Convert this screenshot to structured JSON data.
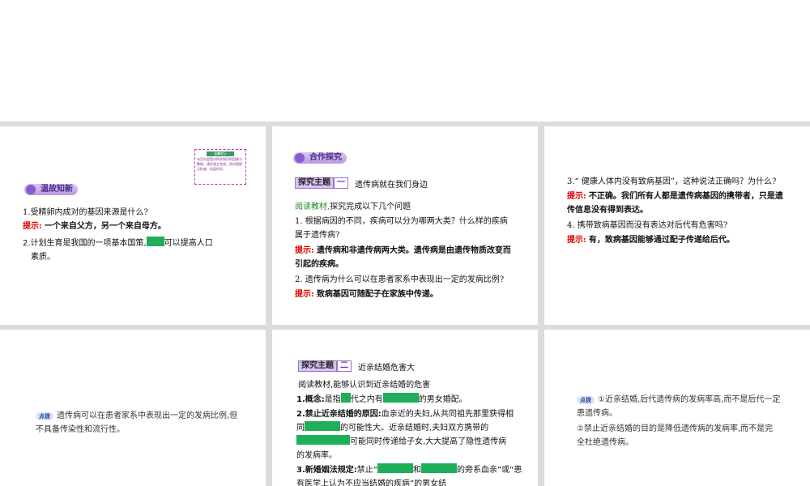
{
  "slide1": {
    "section_label": "温故知新",
    "note_title": "温馨提示",
    "note_body": "本页内容是对所学知识的回顾与整理，请先独立完成，再对照提示检查，巩固所学。",
    "q1": "1.受精卵内成对的基因来源是什么?",
    "q1_hint_label": "提示:",
    "q1_hint": "一个来自父方，另一个来自母方。",
    "q2_part1": "2.计划生育是我国的一项基本国策,",
    "q2_part2": "可以提高人口",
    "q2_part3": "素质。"
  },
  "slide2": {
    "section_label": "合作探究",
    "topic_label": "探究主题",
    "topic_num": "一",
    "topic_title": "遗传病就在我们身边",
    "read_label": "阅读教材,",
    "read_text": "探究完成以下几个问题",
    "q1": "1. 根据病因的不同，疾病可以分为哪两大类？什么样的疾病属于遗传病?",
    "hint_label": "提示:",
    "q1_hint": "遗传病和非遗传病两大类。遗传病是由遗传物质改变而引起的疾病。",
    "q2": "2. 遗传病为什么可以在患者家系中表现出一定的发病比例?",
    "q2_hint": "致病基因可随配子在家族中传递。"
  },
  "slide3": {
    "q3": "3.“ 健康人体内没有致病基因”，这种说法正确吗？为什么?",
    "hint_label": "提示:",
    "q3_hint": "不正确。我们所有人都是遗传病基因的携带者，只是遗传信息没有得到表达。",
    "q4": "4. 携带致病基因而没有表达对后代有危害吗?",
    "q4_hint": "有，致病基因能够通过配子传递给后代。"
  },
  "slide4": {
    "badge": "点拨",
    "text": "遗传病可以在患者家系中表现出一定的发病比例,但不具备传染性和流行性。"
  },
  "slide5": {
    "topic_label": "探究主题",
    "topic_num": "二",
    "topic_title": "近亲结婚危害大",
    "intro": "阅读教材,能够认识到近亲结婚的危害",
    "i1_label": "1.概念:",
    "i1_a": "是指",
    "i1_b": "代之内有",
    "i1_c": "的男女婚配。",
    "i2_label": "2.禁止近亲结婚的原因:",
    "i2_a": "血亲近的夫妇,从共同祖先那里获得相同",
    "i2_b": "的可能性大。近亲结婚时,夫妇双方携带的",
    "i2_c": "可能同时传递给子女,大大提高了隐性遗传病的发病率。",
    "i3_label": "3.新婚姻法规定:",
    "i3_a": "禁止“",
    "i3_b": "和",
    "i3_c": "的旁系血亲”或“患有医学上认为不应当结婚的疾病”的男女结"
  },
  "slide6": {
    "badge": "点拨",
    "p1": "①近亲结婚,后代遗传病的发病率高,而不是后代一定患遗传病。",
    "p2": "②禁止近亲结婚的目的是降低遗传病的发病率,而不是完全杜绝遗传病。"
  },
  "colors": {
    "hint": "#e00000",
    "blank": "#1fae5a",
    "read": "#1a8a1a",
    "divider": "#dcdcdc"
  }
}
